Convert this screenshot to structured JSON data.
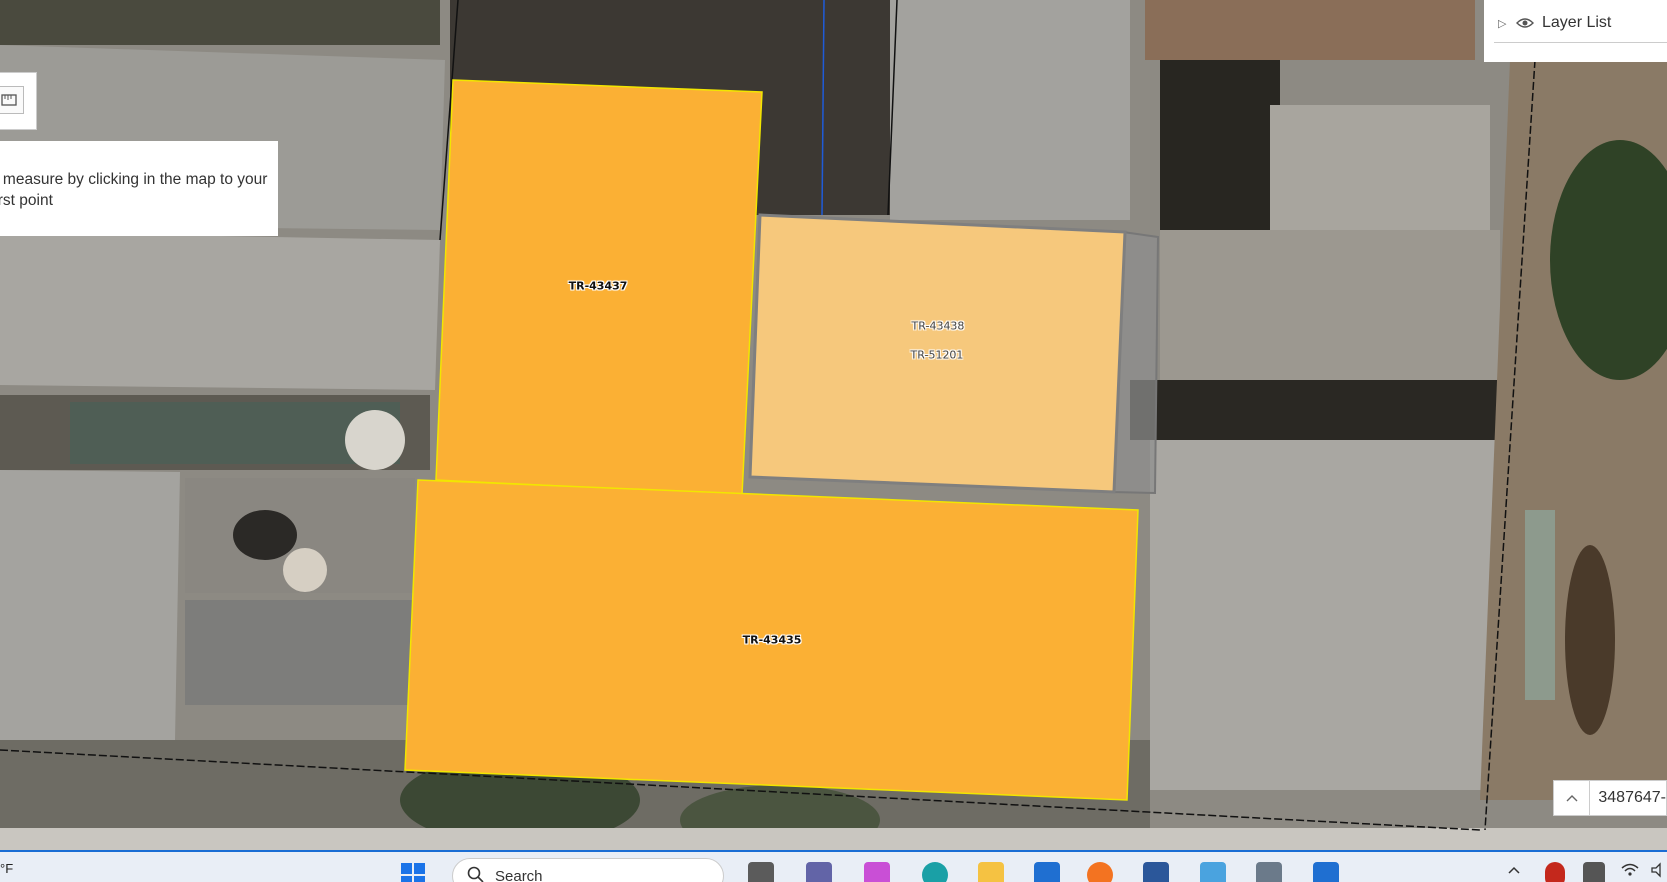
{
  "map": {
    "parcels": [
      {
        "id": "TR-43437"
      },
      {
        "id": "TR-43438"
      },
      {
        "id": "TR-51201"
      },
      {
        "id": "TR-43435"
      }
    ]
  },
  "measure": {
    "hint": "o measure by clicking in the map to your first point"
  },
  "layer_list": {
    "label": "Layer List"
  },
  "coordinates": {
    "value": "3487647-"
  },
  "taskbar": {
    "weather": "°F",
    "search_label": "Search"
  },
  "colors": {
    "parcel_fill": "#fbb034",
    "parcel_selected_fill": "#f6c87c",
    "parcel_outline": "#f2e600",
    "taskbar_accent": "#1a6dd4"
  }
}
